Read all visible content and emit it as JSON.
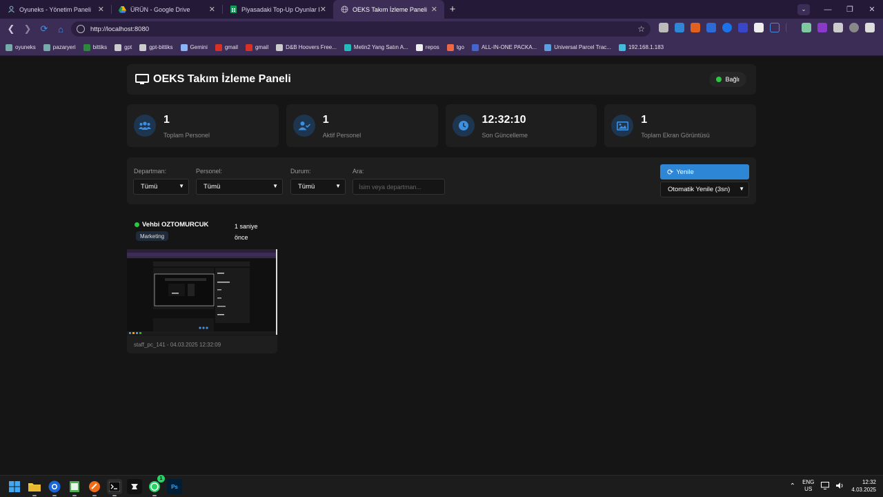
{
  "browser": {
    "tabs": [
      {
        "title": "Oyuneks - Yönetim Paneli",
        "icon": "user-icon",
        "active": false
      },
      {
        "title": "ÜRÜN - Google Drive",
        "icon": "drive-icon",
        "active": false
      },
      {
        "title": "Piyasadaki Top-Up Oyunlar ID Y",
        "icon": "sheets-icon",
        "active": false
      },
      {
        "title": "OEKS Takım İzleme Paneli",
        "icon": "globe-icon",
        "active": true
      }
    ],
    "new_tab": "+",
    "url": "http://localhost:8080",
    "bookmarks": [
      {
        "label": "oyuneks",
        "color": "#7aa"
      },
      {
        "label": "pazaryeri",
        "color": "#7aa"
      },
      {
        "label": "bittiks",
        "color": "#2a8a3a"
      },
      {
        "label": "gpt",
        "color": "#ccc"
      },
      {
        "label": "gpt-bittiks",
        "color": "#ccc"
      },
      {
        "label": "Gemini",
        "color": "#8ab4f8"
      },
      {
        "label": "gmail",
        "color": "#d93025"
      },
      {
        "label": "gmail",
        "color": "#d93025"
      },
      {
        "label": "D&B Hoovers Free...",
        "color": "#ccc"
      },
      {
        "label": "Metin2 Yang Satın A...",
        "color": "#2bb"
      },
      {
        "label": "repos",
        "color": "#eee"
      },
      {
        "label": "tgo",
        "color": "#e64"
      },
      {
        "label": "ALL-IN-ONE PACKA...",
        "color": "#4466cc"
      },
      {
        "label": "Universal Parcel Trac...",
        "color": "#5aa0e0"
      },
      {
        "label": "192.168.1.183",
        "color": "#4bd"
      }
    ]
  },
  "header": {
    "title": "OEKS Takım İzleme Paneli",
    "status": "Bağlı",
    "status_color": "#28c840"
  },
  "stats": [
    {
      "value": "1",
      "label": "Toplam Personel",
      "icon": "users-icon"
    },
    {
      "value": "1",
      "label": "Aktif Personel",
      "icon": "user-check-icon"
    },
    {
      "value": "12:32:10",
      "label": "Son Güncelleme",
      "icon": "clock-icon"
    },
    {
      "value": "1",
      "label": "Toplam Ekran Görüntüsü",
      "icon": "image-icon"
    }
  ],
  "filters": {
    "department_label": "Departman:",
    "department_value": "Tümü",
    "personnel_label": "Personel:",
    "personnel_value": "Tümü",
    "status_label": "Durum:",
    "status_value": "Tümü",
    "search_label": "Ara:",
    "search_placeholder": "İsim veya departman...",
    "refresh_label": "Yenile",
    "auto_refresh_value": "Otomatik Yenile (3sn)"
  },
  "staff": [
    {
      "name": "Vehbi OZTOMURCUK",
      "department": "Marketing",
      "last_seen": "1 saniye önce",
      "caption": "staff_pc_141 - 04.03.2025 12:32:09",
      "online": true
    }
  ],
  "taskbar": {
    "lang_top": "ENG",
    "lang_bottom": "US",
    "time": "12:32",
    "date": "4.03.2025",
    "whatsapp_badge": "1",
    "ps_label": "Ps"
  },
  "colors": {
    "accent": "#2e86d6",
    "online": "#28c840",
    "tab_bar": "#241a38",
    "toolbar": "#3b2d55"
  }
}
